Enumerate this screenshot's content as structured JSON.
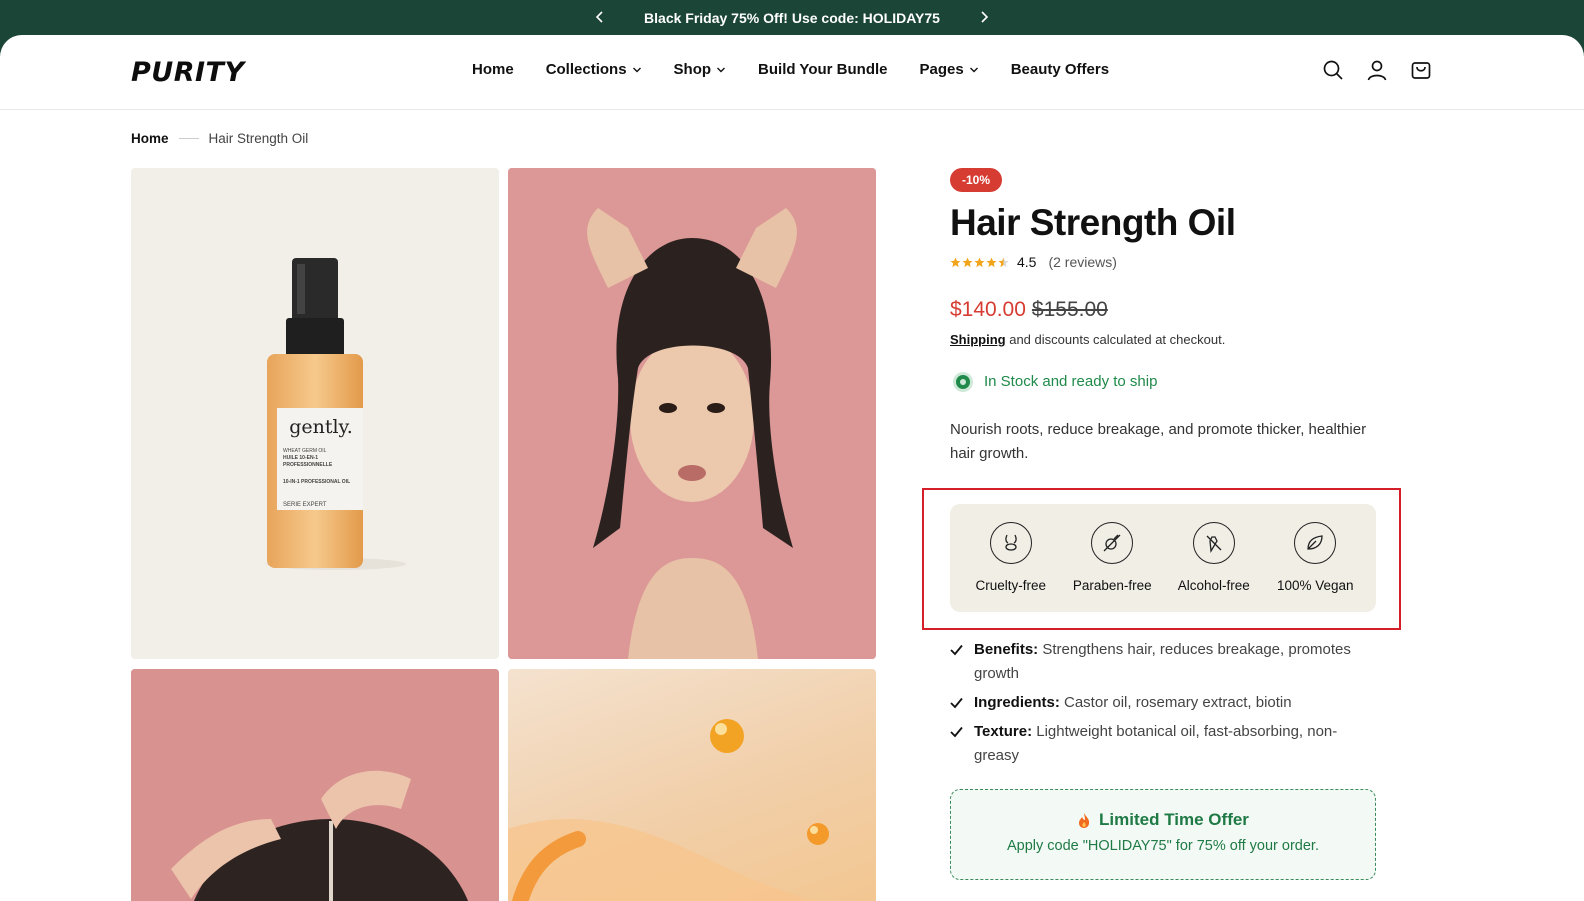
{
  "announcement": {
    "text": "Black Friday 75% Off! Use code: HOLIDAY75"
  },
  "header": {
    "logo": "PURITY",
    "nav": [
      {
        "label": "Home"
      },
      {
        "label": "Collections"
      },
      {
        "label": "Shop"
      },
      {
        "label": "Build Your Bundle"
      },
      {
        "label": "Pages"
      },
      {
        "label": "Beauty Offers"
      }
    ]
  },
  "breadcrumb": {
    "home": "Home",
    "current": "Hair Strength Oil"
  },
  "gallery": {
    "bottle_brand": "gently.",
    "bottle_sub": "WHEAT GERM OIL",
    "bottle_line1": "HUILE 10-EN-1 PROFESSIONNELLE",
    "bottle_line2": "10-IN-1 PROFESSIONAL OIL",
    "bottle_series": "SERIE EXPERT"
  },
  "product": {
    "badge": "-10%",
    "title": "Hair Strength Oil",
    "rating": "4.5",
    "rating_value": 4.5,
    "reviews": "(2 reviews)",
    "sale_price": "$140.00",
    "old_price": "$155.00",
    "shipping_link": "Shipping",
    "shipping_note": " and discounts calculated at checkout.",
    "stock": "In Stock and ready to ship",
    "description": "Nourish roots, reduce breakage, and promote thicker, healthier hair growth.",
    "features": [
      {
        "label": "Cruelty-free",
        "icon": "bunny-icon"
      },
      {
        "label": "Paraben-free",
        "icon": "no-chemical-icon"
      },
      {
        "label": "Alcohol-free",
        "icon": "no-alcohol-icon"
      },
      {
        "label": "100% Vegan",
        "icon": "leaf-icon"
      }
    ],
    "bullets": [
      {
        "key": "Benefits:",
        "value": " Strengthens hair, reduces breakage, promotes growth"
      },
      {
        "key": "Ingredients:",
        "value": " Castor oil, rosemary extract, biotin"
      },
      {
        "key": "Texture:",
        "value": " Lightweight botanical oil, fast-absorbing, non-greasy"
      }
    ],
    "offer": {
      "title": "Limited Time Offer",
      "body": "Apply code \"HOLIDAY75\" for 75% off your order."
    }
  },
  "colors": {
    "brand_green": "#1b4536",
    "sale_red": "#d63c32",
    "stock_green": "#1f8a4a"
  }
}
